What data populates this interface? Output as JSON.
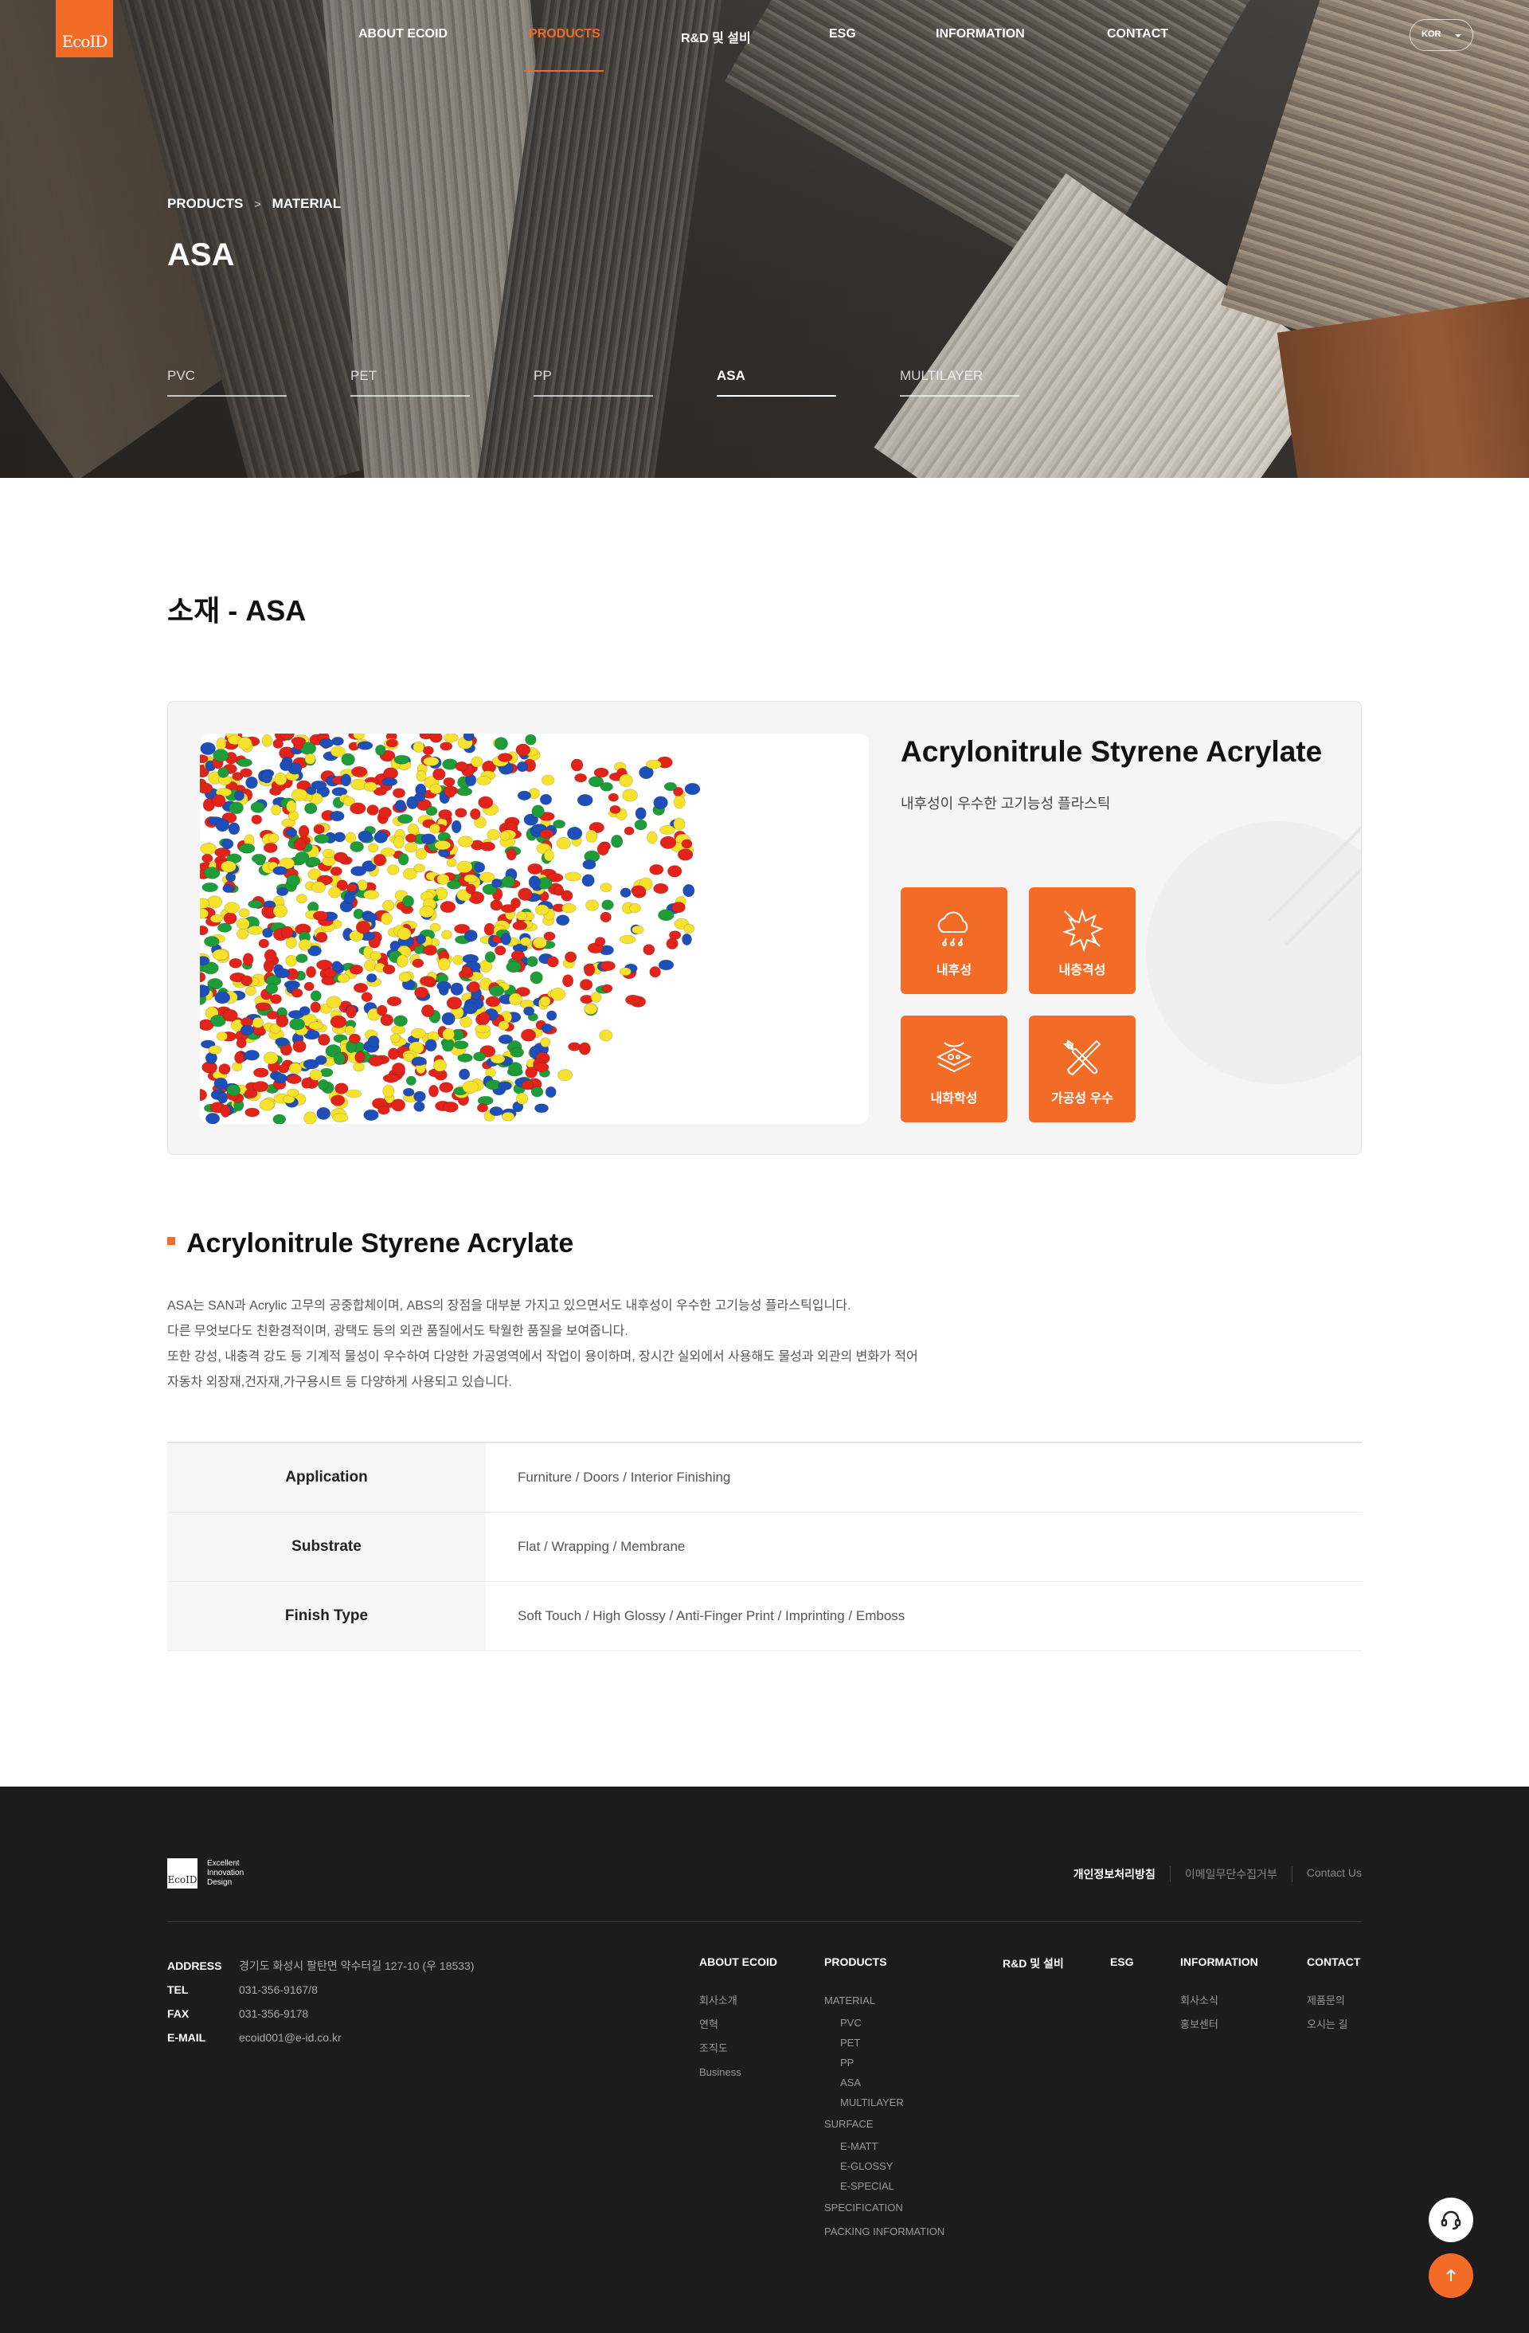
{
  "header": {
    "logo_text": "EcoID",
    "nav": [
      {
        "label": "ABOUT ECOID"
      },
      {
        "label": "PRODUCTS",
        "active": true
      },
      {
        "label": "R&D 및 설비"
      },
      {
        "label": "ESG"
      },
      {
        "label": "INFORMATION"
      },
      {
        "label": "CONTACT"
      }
    ],
    "lang": "KOR",
    "accent": "#f26c28"
  },
  "hero": {
    "breadcrumb": [
      "PRODUCTS",
      "MATERIAL"
    ],
    "title": "ASA",
    "tabs": [
      "PVC",
      "PET",
      "PP",
      "ASA",
      "MULTILAYER"
    ],
    "active_tab": "ASA"
  },
  "main": {
    "section_title": "소재 - ASA",
    "card": {
      "name": "Acrylonitrule Styrene Acrylate",
      "desc": "내후성이 우수한 고기능성 플라스틱",
      "features": [
        {
          "label": "내후성",
          "icon": "weather-cloud-rain-icon"
        },
        {
          "label": "내충격성",
          "icon": "impact-burst-icon"
        },
        {
          "label": "내화학성",
          "icon": "chemical-resistance-icon"
        },
        {
          "label": "가공성 우수",
          "icon": "tools-wrench-screwdriver-icon"
        }
      ]
    },
    "detail_title": "Acrylonitrule Styrene Acrylate",
    "paragraphs": [
      "ASA는 SAN과 Acrylic 고무의 공중합체이며, ABS의 장점을 대부분 가지고 있으면서도 내후성이 우수한 고기능성 플라스틱입니다.",
      "다른 무엇보다도 친환경적이며, 광택도 등의 외관 품질에서도 탁월한 품질을 보여줍니다.",
      "또한 강성, 내충격 강도 등 기계적 물성이 우수하여 다양한 가공영역에서 작업이 용이하며, 장시간 실외에서 사용해도 물성과 외관의 변화가 적어",
      "자동차 외장재,건자재,가구용시트 등 다양하게 사용되고 있습니다."
    ],
    "spec": [
      {
        "label": "Application",
        "value": "Furniture / Doors / Interior Finishing"
      },
      {
        "label": "Substrate",
        "value": "Flat / Wrapping / Membrane"
      },
      {
        "label": "Finish Type",
        "value": "Soft Touch / High Glossy / Anti-Finger Print / Imprinting / Emboss"
      }
    ]
  },
  "footer": {
    "logo_text": "EcoID",
    "tagline": [
      "Excellent",
      "Innovation",
      "Design"
    ],
    "links": [
      "개인정보처리방침",
      "이메일무단수집거부",
      "Contact Us"
    ],
    "info": [
      {
        "key": "ADDRESS",
        "value": "경기도 화성시 팔탄면 약수터길 127-10 (우 18533)"
      },
      {
        "key": "TEL",
        "value": "031-356-9167/8"
      },
      {
        "key": "FAX",
        "value": "031-356-9178"
      },
      {
        "key": "E-MAIL",
        "value": "ecoid001@e-id.co.kr"
      }
    ],
    "columns": {
      "about": {
        "title": "ABOUT ECOID",
        "items": [
          "회사소개",
          "연혁",
          "조직도",
          "Business"
        ]
      },
      "products": {
        "title": "PRODUCTS",
        "material": "MATERIAL",
        "material_items": [
          "PVC",
          "PET",
          "PP",
          "ASA",
          "MULTILAYER"
        ],
        "surface": "SURFACE",
        "surface_items": [
          "E-MATT",
          "E-GLOSSY",
          "E-SPECIAL"
        ],
        "spec": "SPECIFICATION",
        "packing": "PACKING INFORMATION"
      },
      "rnd": {
        "title": "R&D 및 설비"
      },
      "esg": {
        "title": "ESG"
      },
      "information": {
        "title": "INFORMATION",
        "items": [
          "회사소식",
          "홍보센터"
        ]
      },
      "contact": {
        "title": "CONTACT",
        "items": [
          "제품문의",
          "오시는 길"
        ]
      }
    }
  }
}
